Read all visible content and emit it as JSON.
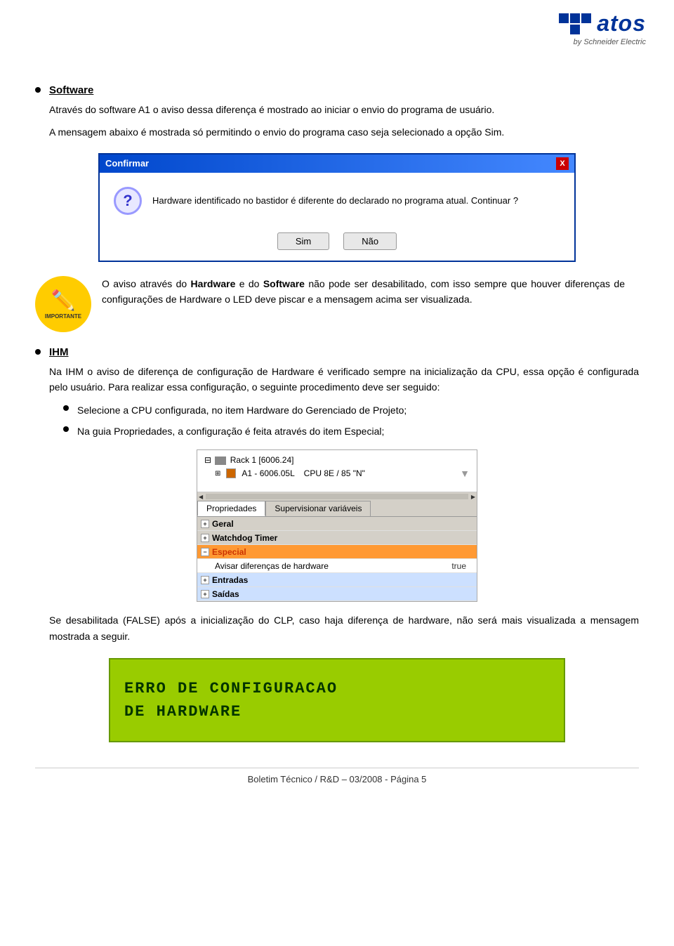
{
  "header": {
    "logo_alt": "Atos by Schneider Electric",
    "by_schneider": "by Schneider Electric"
  },
  "section_software": {
    "title": "Software",
    "para1": "Através do software A1 o aviso dessa diferença é mostrado ao iniciar o envio do programa de usuário.",
    "para2": "A mensagem abaixo é mostrada só permitindo o envio do programa caso seja selecionado a opção Sim."
  },
  "dialog": {
    "title": "Confirmar",
    "message": "Hardware identificado no bastidor é diferente do declarado no programa atual. Continuar ?",
    "btn_yes": "Sim",
    "btn_no": "Não",
    "close_label": "X"
  },
  "important_box": {
    "label": "IMPORTANTE",
    "text_before": "O aviso através do ",
    "bold1": "Hardware",
    "text_middle1": " e do ",
    "bold2": "Software",
    "text_after": " não pode ser desabilitado, com isso sempre que houver diferenças de configurações de Hardware o LED deve piscar e a mensagem acima ser visualizada."
  },
  "section_ihm": {
    "title": "IHM",
    "para1": "Na IHM o aviso de diferença de configuração de Hardware é verificado sempre na inicialização da CPU, essa opção é configurada pelo usuário.",
    "para2": "Para realizar essa configuração, o seguinte procedimento deve ser seguido:",
    "bullet1": "Selecione a CPU configurada, no item Hardware do Gerenciado de Projeto;",
    "bullet2": "Na guia Propriedades, a configuração é feita através do item Especial;"
  },
  "properties_screenshot": {
    "tree_row1": "⊟ ⊞⊞ Rack 1 [6006.24]",
    "tree_row2": "⊞  A1 - 6006.05L   CPU 8E / 85 \"N\"",
    "tab1": "Propriedades",
    "tab2": "Supervisionar variáveis",
    "row_geral": "Geral",
    "row_watchdog": "Watchdog Timer",
    "row_especial": "Especial",
    "row_avisar": "Avisar diferenças de hardware",
    "row_avisar_value": "true",
    "row_entradas": "Entradas",
    "row_saidas": "Saídas"
  },
  "section_false": {
    "para": "Se desabilitada (FALSE) após a inicialização do CLP, caso haja diferença de hardware, não será mais visualizada a mensagem mostrada a seguir."
  },
  "error_display": {
    "line1": "ERRO DE CONFIGURACAO",
    "line2": "DE HARDWARE"
  },
  "footer": {
    "text": "Boletim Técnico  /  R&D – 03/2008  -  Página  5"
  }
}
